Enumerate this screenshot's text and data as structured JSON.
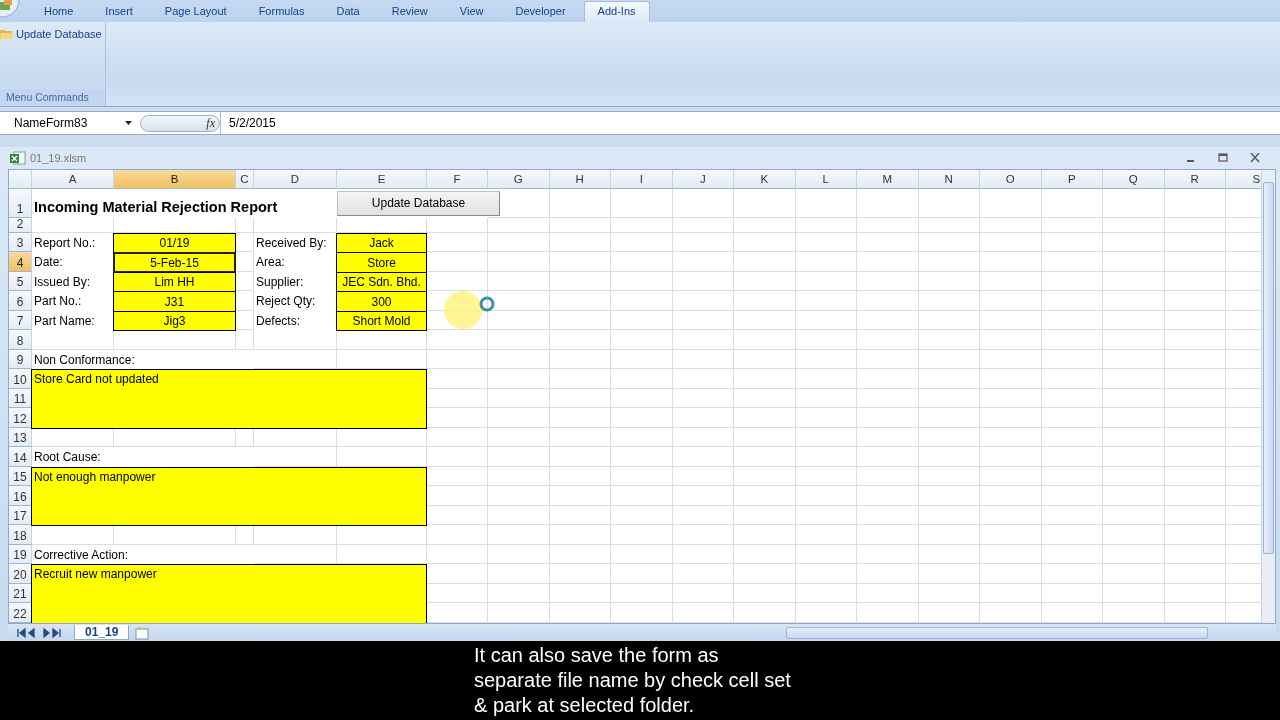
{
  "ribbon": {
    "tabs": [
      {
        "label": "Home",
        "selected": false
      },
      {
        "label": "Insert",
        "selected": false
      },
      {
        "label": "Page Layout",
        "selected": false
      },
      {
        "label": "Formulas",
        "selected": false
      },
      {
        "label": "Data",
        "selected": false
      },
      {
        "label": "Review",
        "selected": false
      },
      {
        "label": "View",
        "selected": false
      },
      {
        "label": "Developer",
        "selected": false
      },
      {
        "label": "Add-Ins",
        "selected": true
      }
    ],
    "group": {
      "button": "Update Database",
      "label": "Menu Commands"
    }
  },
  "formula_bar": {
    "name_box": "NameForm83",
    "function_label": "fx",
    "value": "5/2/2015"
  },
  "workbook": {
    "title": "01_19.xlsm"
  },
  "sheet": {
    "columns": [
      {
        "label": "A",
        "selected": false
      },
      {
        "label": "B",
        "selected": true
      },
      {
        "label": "C",
        "selected": false
      },
      {
        "label": "D",
        "selected": false
      },
      {
        "label": "E",
        "selected": false
      },
      {
        "label": "F",
        "selected": false
      },
      {
        "label": "G",
        "selected": false
      },
      {
        "label": "H",
        "selected": false
      },
      {
        "label": "I",
        "selected": false
      },
      {
        "label": "J",
        "selected": false
      },
      {
        "label": "K",
        "selected": false
      },
      {
        "label": "L",
        "selected": false
      },
      {
        "label": "M",
        "selected": false
      },
      {
        "label": "N",
        "selected": false
      },
      {
        "label": "O",
        "selected": false
      },
      {
        "label": "P",
        "selected": false
      },
      {
        "label": "Q",
        "selected": false
      },
      {
        "label": "R",
        "selected": false
      },
      {
        "label": "S",
        "selected": false
      }
    ],
    "rows": [
      {
        "label": "1",
        "selected": false
      },
      {
        "label": "2",
        "selected": false
      },
      {
        "label": "3",
        "selected": false
      },
      {
        "label": "4",
        "selected": true
      },
      {
        "label": "5",
        "selected": false
      },
      {
        "label": "6",
        "selected": false
      },
      {
        "label": "7",
        "selected": false
      },
      {
        "label": "8",
        "selected": false
      },
      {
        "label": "9",
        "selected": false
      },
      {
        "label": "10",
        "selected": false
      },
      {
        "label": "11",
        "selected": false
      },
      {
        "label": "12",
        "selected": false
      },
      {
        "label": "13",
        "selected": false
      },
      {
        "label": "14",
        "selected": false
      },
      {
        "label": "15",
        "selected": false
      },
      {
        "label": "16",
        "selected": false
      },
      {
        "label": "17",
        "selected": false
      },
      {
        "label": "18",
        "selected": false
      },
      {
        "label": "19",
        "selected": false
      },
      {
        "label": "20",
        "selected": false
      },
      {
        "label": "21",
        "selected": false
      },
      {
        "label": "22",
        "selected": false
      }
    ],
    "form": {
      "title": "Incoming Material  Rejection Report",
      "button": "Update Database",
      "fields": [
        {
          "label": "Report No.:",
          "value": "01/19",
          "selected": false
        },
        {
          "label": "Date:",
          "value": "5-Feb-15",
          "selected": true
        },
        {
          "label": "Issued By:",
          "value": "Lim HH",
          "selected": false
        },
        {
          "label": "Part No.:",
          "value": "J31",
          "selected": false
        },
        {
          "label": "Part Name:",
          "value": "Jig3",
          "selected": false
        },
        {
          "label": "Received By:",
          "value": "Jack",
          "selected": false
        },
        {
          "label": "Area:",
          "value": "Store",
          "selected": false
        },
        {
          "label": "Supplier:",
          "value": "JEC Sdn. Bhd.",
          "selected": false
        },
        {
          "label": "Reject Qty:",
          "value": "300",
          "selected": false
        },
        {
          "label": "Defects:",
          "value": "Short Mold",
          "selected": false
        }
      ],
      "sections": [
        {
          "label": "Non Conformance:",
          "text": "Store Card not updated"
        },
        {
          "label": "Root Cause:",
          "text": "Not enough manpower"
        },
        {
          "label": "Corrective Action:",
          "text": "Recruit new manpower"
        }
      ]
    }
  },
  "sheet_tabs": [
    {
      "label": "01_19",
      "selected": true
    }
  ],
  "caption": "It can also save the form as separate file name by check cell set & park at selected folder."
}
